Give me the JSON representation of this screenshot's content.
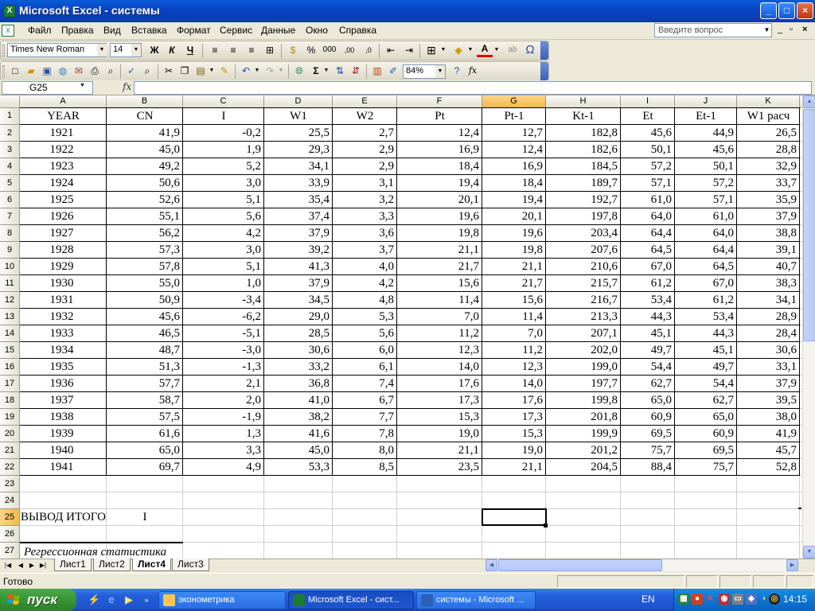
{
  "window": {
    "title": "Microsoft Excel - системы",
    "app_icon": "X",
    "minimize": "_",
    "maximize": "□",
    "close": "×"
  },
  "menu": {
    "items": [
      "Файл",
      "Правка",
      "Вид",
      "Вставка",
      "Формат",
      "Сервис",
      "Данные",
      "Окно",
      "Справка"
    ],
    "help_placeholder": "Введите вопрос",
    "doc_min": "_",
    "doc_restore": "▫",
    "doc_close": "×"
  },
  "format_toolbar": {
    "font": "Times New Roman",
    "size": "14",
    "bold": "Ж",
    "italic": "К",
    "underline": "Ч",
    "percent": "%",
    "thousands": "000",
    "inc_dec": ",00",
    "dec_dec": ",0",
    "sample": "ab",
    "omega": "Ω"
  },
  "standard_toolbar": {
    "zoom": "84%",
    "sigma": "Σ",
    "fx": "fx"
  },
  "formula_bar": {
    "name_box": "G25",
    "fx": "fx",
    "content": ""
  },
  "sheet": {
    "columns": [
      "A",
      "B",
      "C",
      "D",
      "E",
      "F",
      "G",
      "H",
      "I",
      "J",
      "K"
    ],
    "selected_column": "G",
    "selected_row": "25",
    "row_numbers": [
      "1",
      "2",
      "3",
      "4",
      "5",
      "6",
      "7",
      "8",
      "9",
      "10",
      "11",
      "12",
      "13",
      "14",
      "15",
      "16",
      "17",
      "18",
      "19",
      "20",
      "21",
      "22",
      "23",
      "24",
      "25",
      "26",
      "27"
    ],
    "header_row": [
      "YEAR",
      "CN",
      "I",
      "W1",
      "W2",
      "Pt",
      "Pt-1",
      "Kt-1",
      "Et",
      "Et-1",
      "W1 расч"
    ],
    "data_rows": [
      [
        "1921",
        "41,9",
        "-0,2",
        "25,5",
        "2,7",
        "12,4",
        "12,7",
        "182,8",
        "45,6",
        "44,9",
        "26,5"
      ],
      [
        "1922",
        "45,0",
        "1,9",
        "29,3",
        "2,9",
        "16,9",
        "12,4",
        "182,6",
        "50,1",
        "45,6",
        "28,8"
      ],
      [
        "1923",
        "49,2",
        "5,2",
        "34,1",
        "2,9",
        "18,4",
        "16,9",
        "184,5",
        "57,2",
        "50,1",
        "32,9"
      ],
      [
        "1924",
        "50,6",
        "3,0",
        "33,9",
        "3,1",
        "19,4",
        "18,4",
        "189,7",
        "57,1",
        "57,2",
        "33,7"
      ],
      [
        "1925",
        "52,6",
        "5,1",
        "35,4",
        "3,2",
        "20,1",
        "19,4",
        "192,7",
        "61,0",
        "57,1",
        "35,9"
      ],
      [
        "1926",
        "55,1",
        "5,6",
        "37,4",
        "3,3",
        "19,6",
        "20,1",
        "197,8",
        "64,0",
        "61,0",
        "37,9"
      ],
      [
        "1927",
        "56,2",
        "4,2",
        "37,9",
        "3,6",
        "19,8",
        "19,6",
        "203,4",
        "64,4",
        "64,0",
        "38,8"
      ],
      [
        "1928",
        "57,3",
        "3,0",
        "39,2",
        "3,7",
        "21,1",
        "19,8",
        "207,6",
        "64,5",
        "64,4",
        "39,1"
      ],
      [
        "1929",
        "57,8",
        "5,1",
        "41,3",
        "4,0",
        "21,7",
        "21,1",
        "210,6",
        "67,0",
        "64,5",
        "40,7"
      ],
      [
        "1930",
        "55,0",
        "1,0",
        "37,9",
        "4,2",
        "15,6",
        "21,7",
        "215,7",
        "61,2",
        "67,0",
        "38,3"
      ],
      [
        "1931",
        "50,9",
        "-3,4",
        "34,5",
        "4,8",
        "11,4",
        "15,6",
        "216,7",
        "53,4",
        "61,2",
        "34,1"
      ],
      [
        "1932",
        "45,6",
        "-6,2",
        "29,0",
        "5,3",
        "7,0",
        "11,4",
        "213,3",
        "44,3",
        "53,4",
        "28,9"
      ],
      [
        "1933",
        "46,5",
        "-5,1",
        "28,5",
        "5,6",
        "11,2",
        "7,0",
        "207,1",
        "45,1",
        "44,3",
        "28,4"
      ],
      [
        "1934",
        "48,7",
        "-3,0",
        "30,6",
        "6,0",
        "12,3",
        "11,2",
        "202,0",
        "49,7",
        "45,1",
        "30,6"
      ],
      [
        "1935",
        "51,3",
        "-1,3",
        "33,2",
        "6,1",
        "14,0",
        "12,3",
        "199,0",
        "54,4",
        "49,7",
        "33,1"
      ],
      [
        "1936",
        "57,7",
        "2,1",
        "36,8",
        "7,4",
        "17,6",
        "14,0",
        "197,7",
        "62,7",
        "54,4",
        "37,9"
      ],
      [
        "1937",
        "58,7",
        "2,0",
        "41,0",
        "6,7",
        "17,3",
        "17,6",
        "199,8",
        "65,0",
        "62,7",
        "39,5"
      ],
      [
        "1938",
        "57,5",
        "-1,9",
        "38,2",
        "7,7",
        "15,3",
        "17,3",
        "201,8",
        "60,9",
        "65,0",
        "38,0"
      ],
      [
        "1939",
        "61,6",
        "1,3",
        "41,6",
        "7,8",
        "19,0",
        "15,3",
        "199,9",
        "69,5",
        "60,9",
        "41,9"
      ],
      [
        "1940",
        "65,0",
        "3,3",
        "45,0",
        "8,0",
        "21,1",
        "19,0",
        "201,2",
        "75,7",
        "69,5",
        "45,7"
      ],
      [
        "1941",
        "69,7",
        "4,9",
        "53,3",
        "8,5",
        "23,5",
        "21,1",
        "204,5",
        "88,4",
        "75,7",
        "52,8"
      ]
    ],
    "row25_a": "ВЫВОД ИТОГОВ",
    "row25_b": "I",
    "row27_a": "Регрессионная статистика"
  },
  "tabs": {
    "items": [
      "Лист1",
      "Лист2",
      "Лист4",
      "Лист3"
    ],
    "active": "Лист4"
  },
  "status": {
    "text": "Готово"
  },
  "taskbar": {
    "start": "пуск",
    "tasks": [
      "эконометрика",
      "Microsoft Excel - сист...",
      "системы - Microsoft ..."
    ],
    "lang": "EN",
    "clock": "14:15"
  },
  "colors": {
    "title_blue": "#0842c0",
    "start_green": "#3a9a38",
    "selected_header": "#f4b84b"
  }
}
